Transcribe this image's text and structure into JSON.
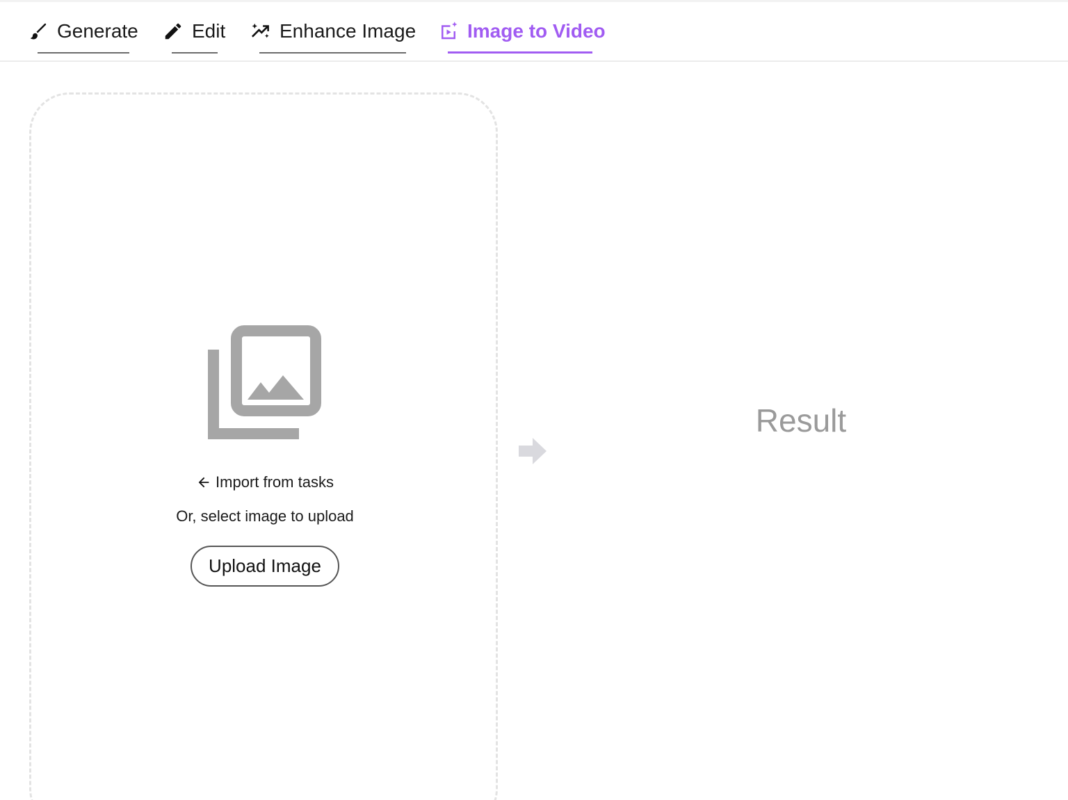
{
  "tabs": [
    {
      "label": "Generate",
      "icon": "brush-icon",
      "active": false
    },
    {
      "label": "Edit",
      "icon": "pencil-icon",
      "active": false
    },
    {
      "label": "Enhance Image",
      "icon": "enhance-icon",
      "active": false
    },
    {
      "label": "Image to Video",
      "icon": "video-sparkle-icon",
      "active": true
    }
  ],
  "colors": {
    "accent": "#a15cf2",
    "placeholder_icon": "#a6a6a6",
    "arrow": "#d9d9de",
    "result_text": "#9a9a9a"
  },
  "upload": {
    "placeholder_icon": "image-stack-icon",
    "import_label": "Import from tasks",
    "select_text": "Or, select image to upload",
    "button_label": "Upload Image"
  },
  "flow_arrow_icon": "arrow-right-icon",
  "result": {
    "label": "Result"
  }
}
